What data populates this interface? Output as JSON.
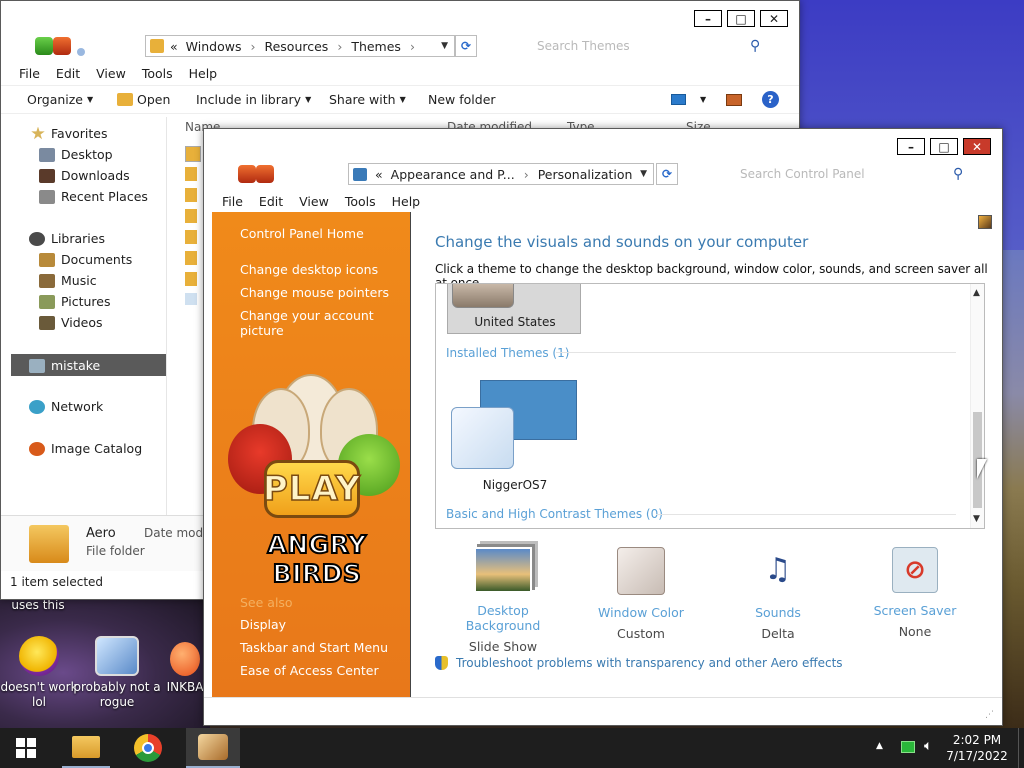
{
  "desktop": {
    "icons": [
      {
        "label": "uses this"
      },
      {
        "label": "doesn't work lol"
      },
      {
        "label": "probably not a rogue"
      },
      {
        "label": "INKBA"
      }
    ]
  },
  "explorer": {
    "address": {
      "crumbs": [
        "«",
        "Windows",
        "Resources",
        "Themes"
      ]
    },
    "search_placeholder": "Search Themes",
    "menu": [
      "File",
      "Edit",
      "View",
      "Tools",
      "Help"
    ],
    "toolbar": {
      "organize": "Organize",
      "open": "Open",
      "include_in_library": "Include in library",
      "share_with": "Share with",
      "new_folder": "New folder"
    },
    "columns": [
      "Name",
      "Date modified",
      "Type",
      "Size"
    ],
    "nav": {
      "favorites": "Favorites",
      "desktop": "Desktop",
      "downloads": "Downloads",
      "recent_places": "Recent Places",
      "libraries": "Libraries",
      "documents": "Documents",
      "music": "Music",
      "pictures": "Pictures",
      "videos": "Videos",
      "mistake": "mistake",
      "network": "Network",
      "image_catalog": "Image Catalog"
    },
    "details": {
      "name": "Aero",
      "date_label": "Date modif",
      "type": "File folder"
    },
    "status": "1 item selected"
  },
  "control_panel": {
    "address": {
      "crumbs": [
        "«",
        "Appearance and P...",
        "Personalization"
      ]
    },
    "search_placeholder": "Search Control Panel",
    "menu": [
      "File",
      "Edit",
      "View",
      "Tools",
      "Help"
    ],
    "sidebar": {
      "home": "Control Panel Home",
      "links": [
        "Change desktop icons",
        "Change mouse pointers",
        "Change your account picture"
      ],
      "see_also": "See also",
      "bottom_links": [
        "Display",
        "Taskbar and Start Menu",
        "Ease of Access Center"
      ],
      "ad_word": "PLAY",
      "ad_brand": "ANGRY BIRDS"
    },
    "heading": "Change the visuals and sounds on your computer",
    "subheading": "Click a theme to change the desktop background, window color, sounds, and screen saver all at once.",
    "themes": {
      "top_theme": "United States",
      "installed_header": "Installed Themes (1)",
      "installed": [
        {
          "name": "NiggerOS7"
        }
      ],
      "basic_header": "Basic and High Contrast Themes (0)"
    },
    "personalize": [
      {
        "title": "Desktop Background",
        "value": "Slide Show"
      },
      {
        "title": "Window Color",
        "value": "Custom"
      },
      {
        "title": "Sounds",
        "value": "Delta"
      },
      {
        "title": "Screen Saver",
        "value": "None"
      }
    ],
    "troubleshoot": "Troubleshoot problems with transparency and other Aero effects"
  },
  "taskbar": {
    "time": "2:02 PM",
    "date": "7/17/2022"
  }
}
